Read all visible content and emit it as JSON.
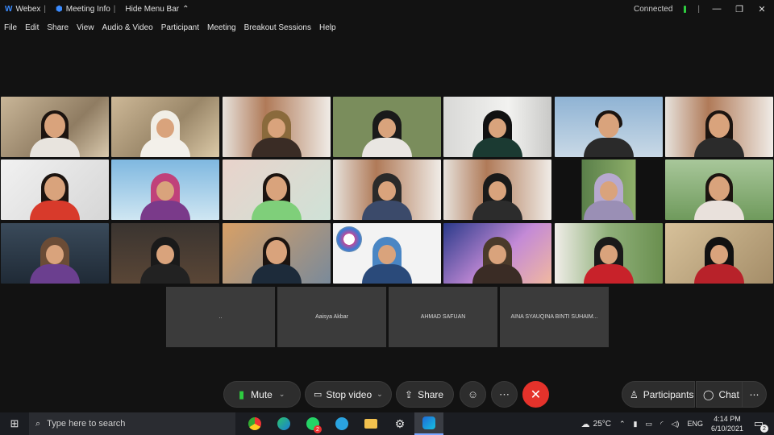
{
  "titlebar": {
    "app": "Webex",
    "meeting_info": "Meeting Info",
    "hide_menu": "Hide Menu Bar",
    "status": "Connected"
  },
  "menu": [
    "File",
    "Edit",
    "Share",
    "View",
    "Audio & Video",
    "Participant",
    "Meeting",
    "Breakout Sessions",
    "Help"
  ],
  "name_tiles": [
    "..",
    "Aaisya Akbar",
    "AHMAD SAFUAN",
    "AINA SYAUQINA BINTI SUHAIM..."
  ],
  "controls": {
    "mute": "Mute",
    "stop_video": "Stop video",
    "share": "Share",
    "participants": "Participants",
    "chat": "Chat"
  },
  "taskbar": {
    "search_placeholder": "Type here to search",
    "weather": "25°C",
    "lang": "ENG",
    "time": "4:14 PM",
    "date": "6/10/2021",
    "notifications": "2",
    "whatsapp_badge": "2"
  },
  "colors": {
    "background": "#121212",
    "end_call": "#e5322b",
    "connected": "#2ecc40"
  }
}
